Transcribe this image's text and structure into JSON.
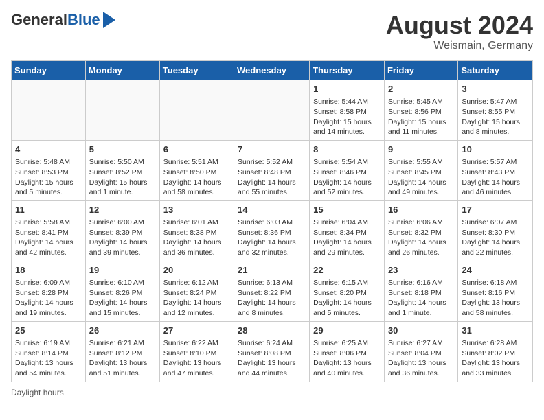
{
  "header": {
    "logo_general": "General",
    "logo_blue": "Blue",
    "month": "August 2024",
    "location": "Weismain, Germany"
  },
  "footer": {
    "note": "Daylight hours"
  },
  "days_of_week": [
    "Sunday",
    "Monday",
    "Tuesday",
    "Wednesday",
    "Thursday",
    "Friday",
    "Saturday"
  ],
  "weeks": [
    [
      {
        "day": "",
        "info": ""
      },
      {
        "day": "",
        "info": ""
      },
      {
        "day": "",
        "info": ""
      },
      {
        "day": "",
        "info": ""
      },
      {
        "day": "1",
        "info": "Sunrise: 5:44 AM\nSunset: 8:58 PM\nDaylight: 15 hours and 14 minutes."
      },
      {
        "day": "2",
        "info": "Sunrise: 5:45 AM\nSunset: 8:56 PM\nDaylight: 15 hours and 11 minutes."
      },
      {
        "day": "3",
        "info": "Sunrise: 5:47 AM\nSunset: 8:55 PM\nDaylight: 15 hours and 8 minutes."
      }
    ],
    [
      {
        "day": "4",
        "info": "Sunrise: 5:48 AM\nSunset: 8:53 PM\nDaylight: 15 hours and 5 minutes."
      },
      {
        "day": "5",
        "info": "Sunrise: 5:50 AM\nSunset: 8:52 PM\nDaylight: 15 hours and 1 minute."
      },
      {
        "day": "6",
        "info": "Sunrise: 5:51 AM\nSunset: 8:50 PM\nDaylight: 14 hours and 58 minutes."
      },
      {
        "day": "7",
        "info": "Sunrise: 5:52 AM\nSunset: 8:48 PM\nDaylight: 14 hours and 55 minutes."
      },
      {
        "day": "8",
        "info": "Sunrise: 5:54 AM\nSunset: 8:46 PM\nDaylight: 14 hours and 52 minutes."
      },
      {
        "day": "9",
        "info": "Sunrise: 5:55 AM\nSunset: 8:45 PM\nDaylight: 14 hours and 49 minutes."
      },
      {
        "day": "10",
        "info": "Sunrise: 5:57 AM\nSunset: 8:43 PM\nDaylight: 14 hours and 46 minutes."
      }
    ],
    [
      {
        "day": "11",
        "info": "Sunrise: 5:58 AM\nSunset: 8:41 PM\nDaylight: 14 hours and 42 minutes."
      },
      {
        "day": "12",
        "info": "Sunrise: 6:00 AM\nSunset: 8:39 PM\nDaylight: 14 hours and 39 minutes."
      },
      {
        "day": "13",
        "info": "Sunrise: 6:01 AM\nSunset: 8:38 PM\nDaylight: 14 hours and 36 minutes."
      },
      {
        "day": "14",
        "info": "Sunrise: 6:03 AM\nSunset: 8:36 PM\nDaylight: 14 hours and 32 minutes."
      },
      {
        "day": "15",
        "info": "Sunrise: 6:04 AM\nSunset: 8:34 PM\nDaylight: 14 hours and 29 minutes."
      },
      {
        "day": "16",
        "info": "Sunrise: 6:06 AM\nSunset: 8:32 PM\nDaylight: 14 hours and 26 minutes."
      },
      {
        "day": "17",
        "info": "Sunrise: 6:07 AM\nSunset: 8:30 PM\nDaylight: 14 hours and 22 minutes."
      }
    ],
    [
      {
        "day": "18",
        "info": "Sunrise: 6:09 AM\nSunset: 8:28 PM\nDaylight: 14 hours and 19 minutes."
      },
      {
        "day": "19",
        "info": "Sunrise: 6:10 AM\nSunset: 8:26 PM\nDaylight: 14 hours and 15 minutes."
      },
      {
        "day": "20",
        "info": "Sunrise: 6:12 AM\nSunset: 8:24 PM\nDaylight: 14 hours and 12 minutes."
      },
      {
        "day": "21",
        "info": "Sunrise: 6:13 AM\nSunset: 8:22 PM\nDaylight: 14 hours and 8 minutes."
      },
      {
        "day": "22",
        "info": "Sunrise: 6:15 AM\nSunset: 8:20 PM\nDaylight: 14 hours and 5 minutes."
      },
      {
        "day": "23",
        "info": "Sunrise: 6:16 AM\nSunset: 8:18 PM\nDaylight: 14 hours and 1 minute."
      },
      {
        "day": "24",
        "info": "Sunrise: 6:18 AM\nSunset: 8:16 PM\nDaylight: 13 hours and 58 minutes."
      }
    ],
    [
      {
        "day": "25",
        "info": "Sunrise: 6:19 AM\nSunset: 8:14 PM\nDaylight: 13 hours and 54 minutes."
      },
      {
        "day": "26",
        "info": "Sunrise: 6:21 AM\nSunset: 8:12 PM\nDaylight: 13 hours and 51 minutes."
      },
      {
        "day": "27",
        "info": "Sunrise: 6:22 AM\nSunset: 8:10 PM\nDaylight: 13 hours and 47 minutes."
      },
      {
        "day": "28",
        "info": "Sunrise: 6:24 AM\nSunset: 8:08 PM\nDaylight: 13 hours and 44 minutes."
      },
      {
        "day": "29",
        "info": "Sunrise: 6:25 AM\nSunset: 8:06 PM\nDaylight: 13 hours and 40 minutes."
      },
      {
        "day": "30",
        "info": "Sunrise: 6:27 AM\nSunset: 8:04 PM\nDaylight: 13 hours and 36 minutes."
      },
      {
        "day": "31",
        "info": "Sunrise: 6:28 AM\nSunset: 8:02 PM\nDaylight: 13 hours and 33 minutes."
      }
    ]
  ]
}
